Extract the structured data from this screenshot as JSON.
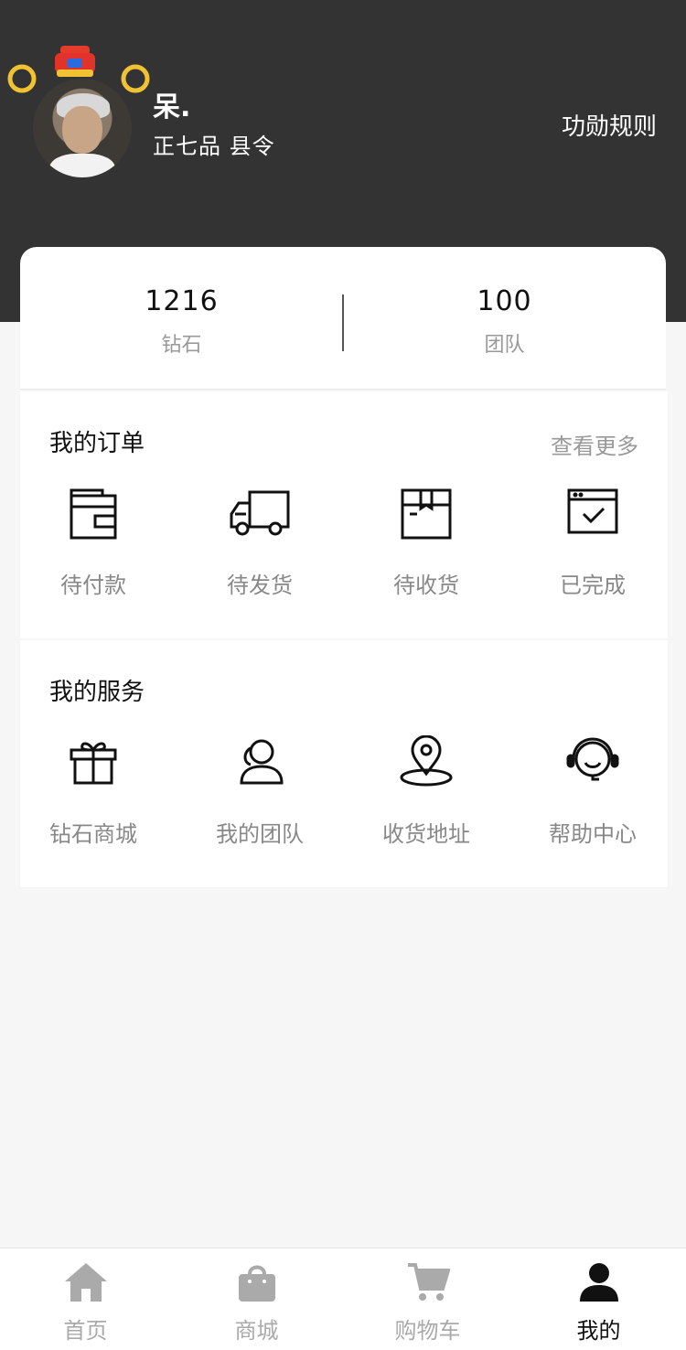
{
  "profile": {
    "name": "呆.",
    "rank": "正七品 县令",
    "rules_link": "功勋规则"
  },
  "stats": [
    {
      "value": "1216",
      "label": "钻石"
    },
    {
      "value": "100",
      "label": "团队"
    }
  ],
  "orders": {
    "title": "我的订单",
    "more": "查看更多",
    "items": [
      {
        "label": "待付款",
        "icon": "wallet-icon"
      },
      {
        "label": "待发货",
        "icon": "truck-icon"
      },
      {
        "label": "待收货",
        "icon": "package-icon"
      },
      {
        "label": "已完成",
        "icon": "completed-window-icon"
      }
    ]
  },
  "services": {
    "title": "我的服务",
    "items": [
      {
        "label": "钻石商城",
        "icon": "gift-icon"
      },
      {
        "label": "我的团队",
        "icon": "team-icon"
      },
      {
        "label": "收货地址",
        "icon": "location-pin-icon"
      },
      {
        "label": "帮助中心",
        "icon": "headset-icon"
      }
    ]
  },
  "tabbar": {
    "items": [
      {
        "label": "首页",
        "icon": "home-icon",
        "active": false
      },
      {
        "label": "商城",
        "icon": "shopping-bag-icon",
        "active": false
      },
      {
        "label": "购物车",
        "icon": "cart-icon",
        "active": false
      },
      {
        "label": "我的",
        "icon": "user-icon",
        "active": true
      }
    ]
  },
  "colors": {
    "header_bg": "#333333",
    "page_bg": "#f6f6f6",
    "muted_text": "#999999",
    "inactive_tab": "#aaaaaa",
    "active_tab": "#111111"
  }
}
